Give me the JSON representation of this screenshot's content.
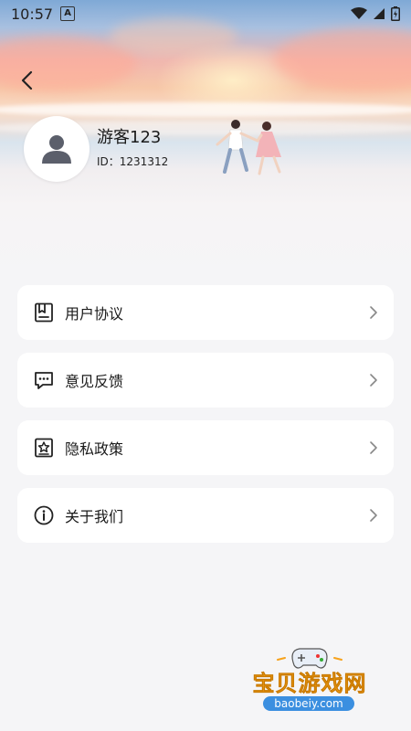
{
  "status_bar": {
    "time": "10:57"
  },
  "profile": {
    "name": "游客123",
    "id_text": "ID：1231312"
  },
  "menu": [
    {
      "label": "用户协议",
      "icon": "document-icon"
    },
    {
      "label": "意见反馈",
      "icon": "feedback-icon"
    },
    {
      "label": "隐私政策",
      "icon": "privacy-icon"
    },
    {
      "label": "关于我们",
      "icon": "info-icon"
    }
  ],
  "watermark": {
    "title": "宝贝游戏网",
    "url": "baobeiy.com"
  },
  "colors": {
    "background": "#f5f5f7",
    "card": "#ffffff",
    "watermark_orange": "#f7a21b",
    "watermark_blue": "#3b8fe0"
  }
}
